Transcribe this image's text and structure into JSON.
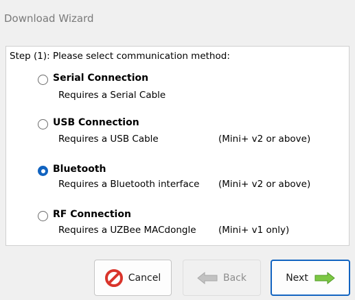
{
  "window": {
    "title": "Download Wizard"
  },
  "step_prompt": "Step (1): Please select communication method:",
  "options": [
    {
      "title": "Serial Connection",
      "description": "Requires a Serial Cable",
      "note": "",
      "selected": false
    },
    {
      "title": "USB Connection",
      "description": "Requires a USB Cable",
      "note": "(Mini+ v2 or above)",
      "selected": false
    },
    {
      "title": "Bluetooth",
      "description": "Requires a Bluetooth interface",
      "note": "(Mini+ v2 or above)",
      "selected": true
    },
    {
      "title": "RF Connection",
      "description": "Requires a UZBee MACdongle",
      "note": "(Mini+ v1 only)",
      "selected": false
    }
  ],
  "buttons": {
    "cancel": {
      "label": "Cancel",
      "icon": "cancel-icon",
      "enabled": true
    },
    "back": {
      "label": "Back",
      "icon": "arrow-left-icon",
      "enabled": false
    },
    "next": {
      "label": "Next",
      "icon": "arrow-right-icon",
      "enabled": true
    }
  },
  "colors": {
    "accent": "#1163c0",
    "cancel_icon": "#d9342b",
    "next_arrow": "#7cc744",
    "back_arrow_disabled": "#c2c2c2"
  }
}
